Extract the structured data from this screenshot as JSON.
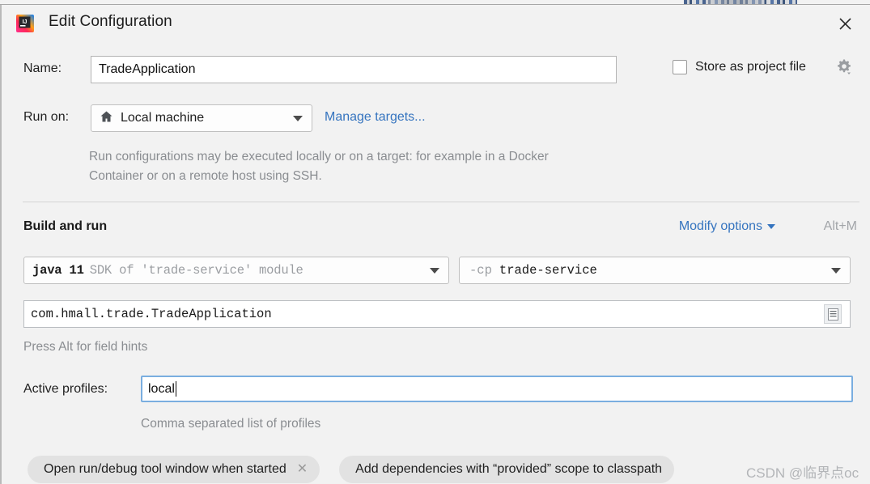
{
  "window": {
    "title": "Edit Configuration",
    "app_icon": "intellij-idea-icon",
    "close_icon": "close-icon"
  },
  "name_row": {
    "label": "Name:",
    "value": "TradeApplication",
    "placeholder": ""
  },
  "store_as_project_file": {
    "label": "Store as project file",
    "checked": false,
    "gear_icon": "gear-icon"
  },
  "run_on": {
    "label": "Run on:",
    "value": "Local machine",
    "icon": "home-icon",
    "manage_targets_link": "Manage targets...",
    "description": "Run configurations may be executed locally or on a target: for example in a Docker Container or on a remote host using SSH."
  },
  "build_and_run": {
    "title": "Build and run",
    "modify_options_link": "Modify options",
    "modify_options_caret": "chevron-down-icon",
    "shortcut": "Alt+M",
    "jdk": {
      "primary": "java 11",
      "secondary": "SDK of 'trade-service' module"
    },
    "classpath": {
      "flag": "-cp",
      "value": "trade-service"
    },
    "main_class": {
      "value": "com.hmall.trade.TradeApplication",
      "browse_icon": "document-list-icon"
    },
    "field_hint": "Press Alt for field hints"
  },
  "active_profiles": {
    "label": "Active profiles:",
    "value": "local",
    "hint": "Comma separated list of profiles"
  },
  "option_chips": [
    {
      "label": "Open run/debug tool window when started",
      "removable": true,
      "remove_icon": "close-icon"
    },
    {
      "label": "Add dependencies with “provided” scope to classpath",
      "removable": false
    }
  ],
  "watermark": "CSDN @临界点oc",
  "colors": {
    "link": "#3574bf",
    "dialog_bg": "#f2f2f2",
    "field_bg": "#ffffff",
    "focus_border": "#7aaee0",
    "muted_text": "#8a8d91",
    "chip_bg": "#e2e2e2"
  }
}
